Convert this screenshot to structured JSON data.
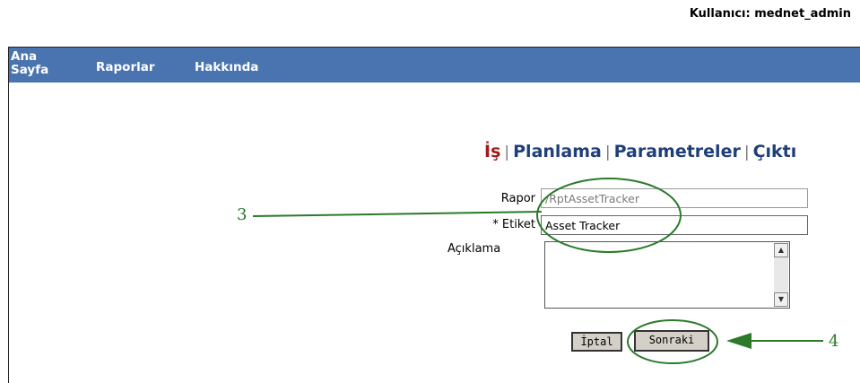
{
  "header": {
    "user_label": "Kullanıcı: mednet_admin"
  },
  "nav": {
    "items": [
      "Ana Sayfa",
      "Raporlar",
      "Hakkında"
    ]
  },
  "wizard": {
    "steps": [
      "İş",
      "Planlama",
      "Parametreler",
      "Çıktı"
    ],
    "separator": "|",
    "active_step": "İş"
  },
  "form": {
    "rapor_label": "Rapor",
    "rapor_value": "/RptAssetTracker",
    "etiket_label": "* Etiket",
    "etiket_value": "Asset Tracker",
    "aciklama_label": "Açıklama",
    "aciklama_value": ""
  },
  "buttons": {
    "cancel": "İptal",
    "next": "Sonraki"
  },
  "annotations": {
    "callout_3": "3",
    "callout_4": "4"
  },
  "colors": {
    "nav_bg": "#4a74b0",
    "active_step": "#a01c1c",
    "step": "#1f3f7a",
    "annotation": "#2a7a2a"
  }
}
